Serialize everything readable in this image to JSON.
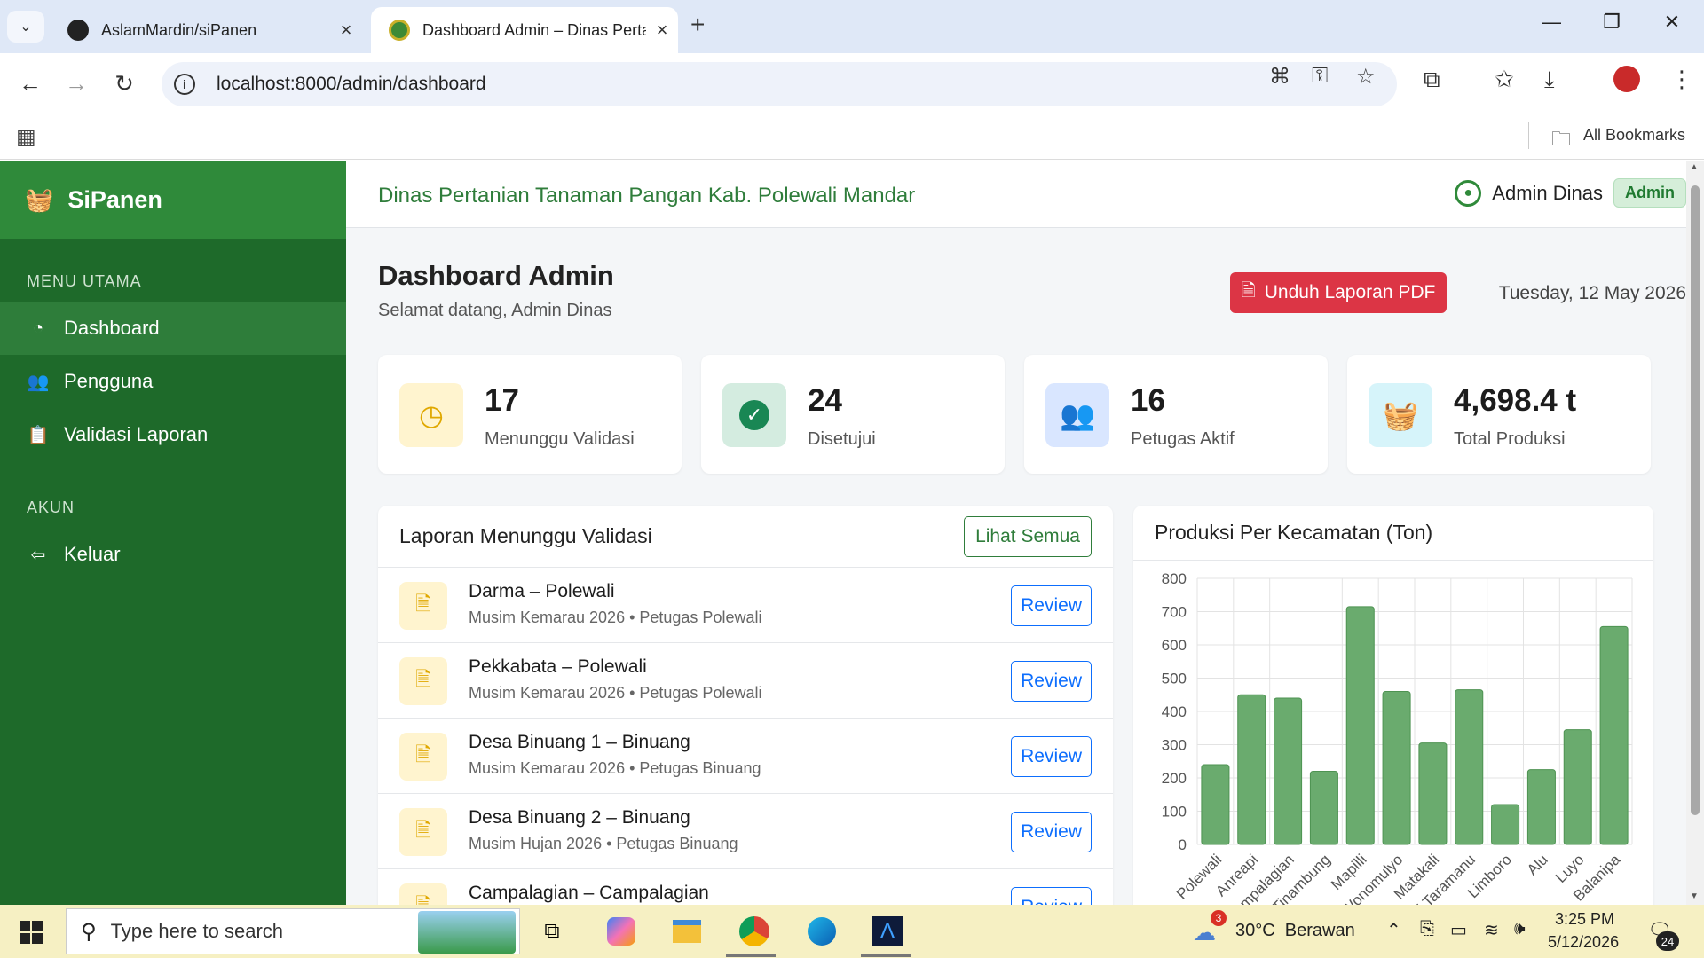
{
  "browser": {
    "tabs": [
      {
        "title": "AslamMardin/siPanen",
        "active": false
      },
      {
        "title": "Dashboard Admin – Dinas Perta",
        "active": true
      }
    ],
    "url": "localhost:8000/admin/dashboard",
    "bookmarks_label": "All Bookmarks"
  },
  "sidebar": {
    "brand": "SiPanen",
    "section_main": "MENU UTAMA",
    "items": [
      {
        "label": "Dashboard",
        "icon": "gauge-icon",
        "active": true
      },
      {
        "label": "Pengguna",
        "icon": "users-icon",
        "active": false
      },
      {
        "label": "Validasi Laporan",
        "icon": "clipboard-icon",
        "active": false
      }
    ],
    "section_account": "AKUN",
    "logout": "Keluar"
  },
  "header": {
    "org_name": "Dinas Pertanian Tanaman Pangan Kab. Polewali Mandar",
    "user_name": "Admin Dinas",
    "role_badge": "Admin"
  },
  "page": {
    "title": "Dashboard Admin",
    "subtitle": "Selamat datang, Admin Dinas",
    "pdf_button": "Unduh Laporan PDF",
    "date": "Tuesday, 12 May 2026"
  },
  "stats": [
    {
      "value": "17",
      "label": "Menunggu Validasi",
      "icon": "clock-icon",
      "bg": "#fff4cf",
      "fg": "#e0a800"
    },
    {
      "value": "24",
      "label": "Disetujui",
      "icon": "check-circle-icon",
      "bg": "#d4ece0",
      "fg": "#198754"
    },
    {
      "value": "16",
      "label": "Petugas Aktif",
      "icon": "users-icon",
      "bg": "#d9e6ff",
      "fg": "#0d6efd"
    },
    {
      "value": "4,698.4 t",
      "label": "Total Produksi",
      "icon": "basket-icon",
      "bg": "#d6f4fa",
      "fg": "#0dcaf0"
    }
  ],
  "pending": {
    "title": "Laporan Menunggu Validasi",
    "view_all": "Lihat Semua",
    "review_label": "Review",
    "rows": [
      {
        "title": "Darma – Polewali",
        "sub": "Musim Kemarau 2026 • Petugas Polewali"
      },
      {
        "title": "Pekkabata – Polewali",
        "sub": "Musim Kemarau 2026 • Petugas Polewali"
      },
      {
        "title": "Desa Binuang 1 – Binuang",
        "sub": "Musim Kemarau 2026 • Petugas Binuang"
      },
      {
        "title": "Desa Binuang 2 – Binuang",
        "sub": "Musim Hujan 2026 • Petugas Binuang"
      },
      {
        "title": "Campalagian – Campalagian",
        "sub": ""
      }
    ]
  },
  "chart_panel_title": "Produksi Per Kecamatan (Ton)",
  "chart_data": {
    "type": "bar",
    "categories": [
      "Polewali",
      "Anreapi",
      "Campalagian",
      "Tinambung",
      "Mapilli",
      "Wonomulyo",
      "Matakali",
      "Tubbi Taramanu",
      "Limboro",
      "Alu",
      "Luyo",
      "Balanipa"
    ],
    "category_labels_visible": [
      "Polewali",
      "Anreapi",
      "Campalagian",
      "Tinambung",
      "Mapilli",
      "Wonomulyo",
      "Matakali",
      "bbi Taramanu",
      "Limboro",
      "Alu",
      "Luyo",
      "Balanipa"
    ],
    "values": [
      240,
      450,
      440,
      220,
      715,
      460,
      305,
      465,
      120,
      225,
      345,
      655
    ],
    "ylim": [
      0,
      800
    ],
    "yticks": [
      0,
      100,
      200,
      300,
      400,
      500,
      600,
      700,
      800
    ],
    "grid": true,
    "bar_color": "#6aab6e",
    "bar_border": "#4e9352"
  },
  "taskbar": {
    "search_placeholder": "Type here to search",
    "weather_badge": "3",
    "weather": "30°C  Berawan",
    "time": "3:25 PM",
    "date": "5/12/2026",
    "notif_count": "24"
  }
}
